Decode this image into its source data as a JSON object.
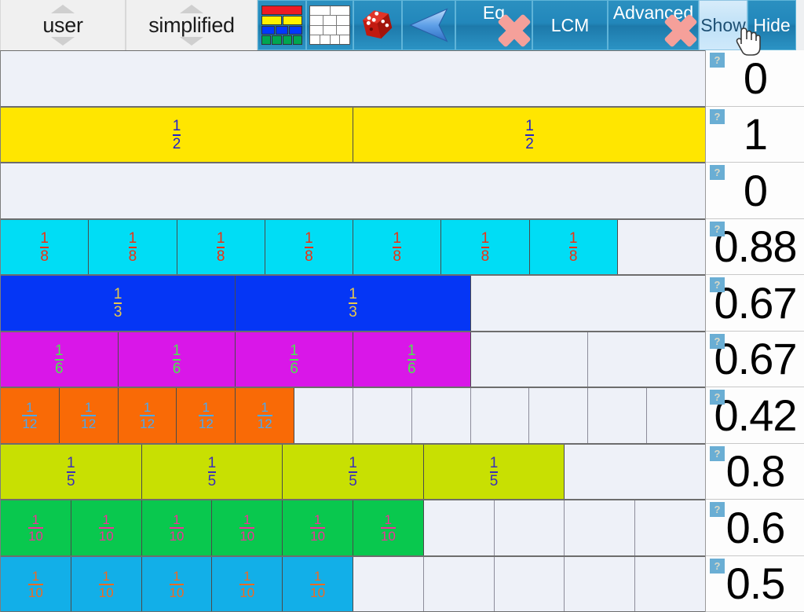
{
  "toolbar": {
    "spinners": [
      {
        "label": "user",
        "name": "user-spinner"
      },
      {
        "label": "simplified",
        "name": "simplified-spinner"
      }
    ],
    "buttons": [
      {
        "name": "color-bars-button",
        "label": "",
        "icon": "color-bars-icon",
        "kind": "icon",
        "x": false,
        "light": false
      },
      {
        "name": "grid-button",
        "label": "",
        "icon": "brick-grid-icon",
        "kind": "icon",
        "x": false,
        "light": false
      },
      {
        "name": "random-die-button",
        "label": "",
        "icon": "die-icon",
        "kind": "icon",
        "x": false,
        "light": false
      },
      {
        "name": "back-arrow-button",
        "label": "",
        "icon": "left-arrow-icon",
        "kind": "icon",
        "x": false,
        "light": false
      },
      {
        "name": "equals-button",
        "label": "Eq",
        "icon": "x-mark-icon",
        "kind": "text-up",
        "x": true,
        "light": false
      },
      {
        "name": "lcm-button",
        "label": "LCM",
        "icon": "",
        "kind": "text",
        "x": false,
        "light": false
      },
      {
        "name": "advanced-button",
        "label": "Advanced",
        "icon": "x-mark-icon",
        "kind": "text-up",
        "x": true,
        "light": false
      },
      {
        "name": "show-button",
        "label": "Show",
        "icon": "",
        "kind": "text",
        "x": false,
        "light": true
      },
      {
        "name": "hide-button",
        "label": "Hide",
        "icon": "",
        "kind": "text",
        "x": false,
        "light": false
      }
    ]
  },
  "badge_glyph": "?",
  "colors": {
    "halves": "#FFE600",
    "eighths": "#00DDF5",
    "thirds": "#0536F5",
    "sixths": "#D917E8",
    "twelfths": "#F96A06",
    "fifths": "#C8E002",
    "tenths_green": "#09C84E",
    "tenths_blue": "#12AFE8",
    "empty": "#EEF1F8",
    "toolbar_blue": "#2287BB",
    "toolbar_light": "#BFE1F7",
    "x_mark": "#F5A09A"
  },
  "rows": [
    {
      "name": "row-empty-1",
      "denominator": 1,
      "filled": 0,
      "label": "",
      "fill": "#EEF1F8",
      "text": "#3a3aa0",
      "value": "0",
      "show_labels": false
    },
    {
      "name": "row-halves",
      "denominator": 2,
      "filled": 2,
      "label": "1/2",
      "fill": "#FFE600",
      "text": "#2222CC",
      "value": "1",
      "show_labels": true
    },
    {
      "name": "row-empty-2",
      "denominator": 1,
      "filled": 0,
      "label": "",
      "fill": "#EEF1F8",
      "text": "#3a3aa0",
      "value": "0",
      "show_labels": false
    },
    {
      "name": "row-eighths",
      "denominator": 8,
      "filled": 7,
      "label": "1/8",
      "fill": "#00DDF5",
      "text": "#F03010",
      "value": "0.88",
      "show_labels": true
    },
    {
      "name": "row-thirds",
      "denominator": 3,
      "filled": 2,
      "label": "1/3",
      "fill": "#0536F5",
      "text": "#E8C84A",
      "value": "0.67",
      "show_labels": true
    },
    {
      "name": "row-sixths",
      "denominator": 6,
      "filled": 4,
      "label": "1/6",
      "fill": "#D917E8",
      "text": "#4CE84C",
      "value": "0.67",
      "show_labels": true
    },
    {
      "name": "row-twelfths",
      "denominator": 12,
      "filled": 5,
      "label": "1/12",
      "fill": "#F96A06",
      "text": "#4AA8F0",
      "value": "0.42",
      "show_labels": true
    },
    {
      "name": "row-fifths",
      "denominator": 5,
      "filled": 4,
      "label": "1/5",
      "fill": "#C8E002",
      "text": "#3A30B8",
      "value": "0.8",
      "show_labels": true
    },
    {
      "name": "row-tenths-green",
      "denominator": 10,
      "filled": 6,
      "label": "1/10",
      "fill": "#09C84E",
      "text": "#F0309A",
      "value": "0.6",
      "show_labels": true
    },
    {
      "name": "row-tenths-blue",
      "denominator": 10,
      "filled": 5,
      "label": "1/10",
      "fill": "#12AFE8",
      "text": "#F06A20",
      "value": "0.5",
      "show_labels": true
    }
  ]
}
